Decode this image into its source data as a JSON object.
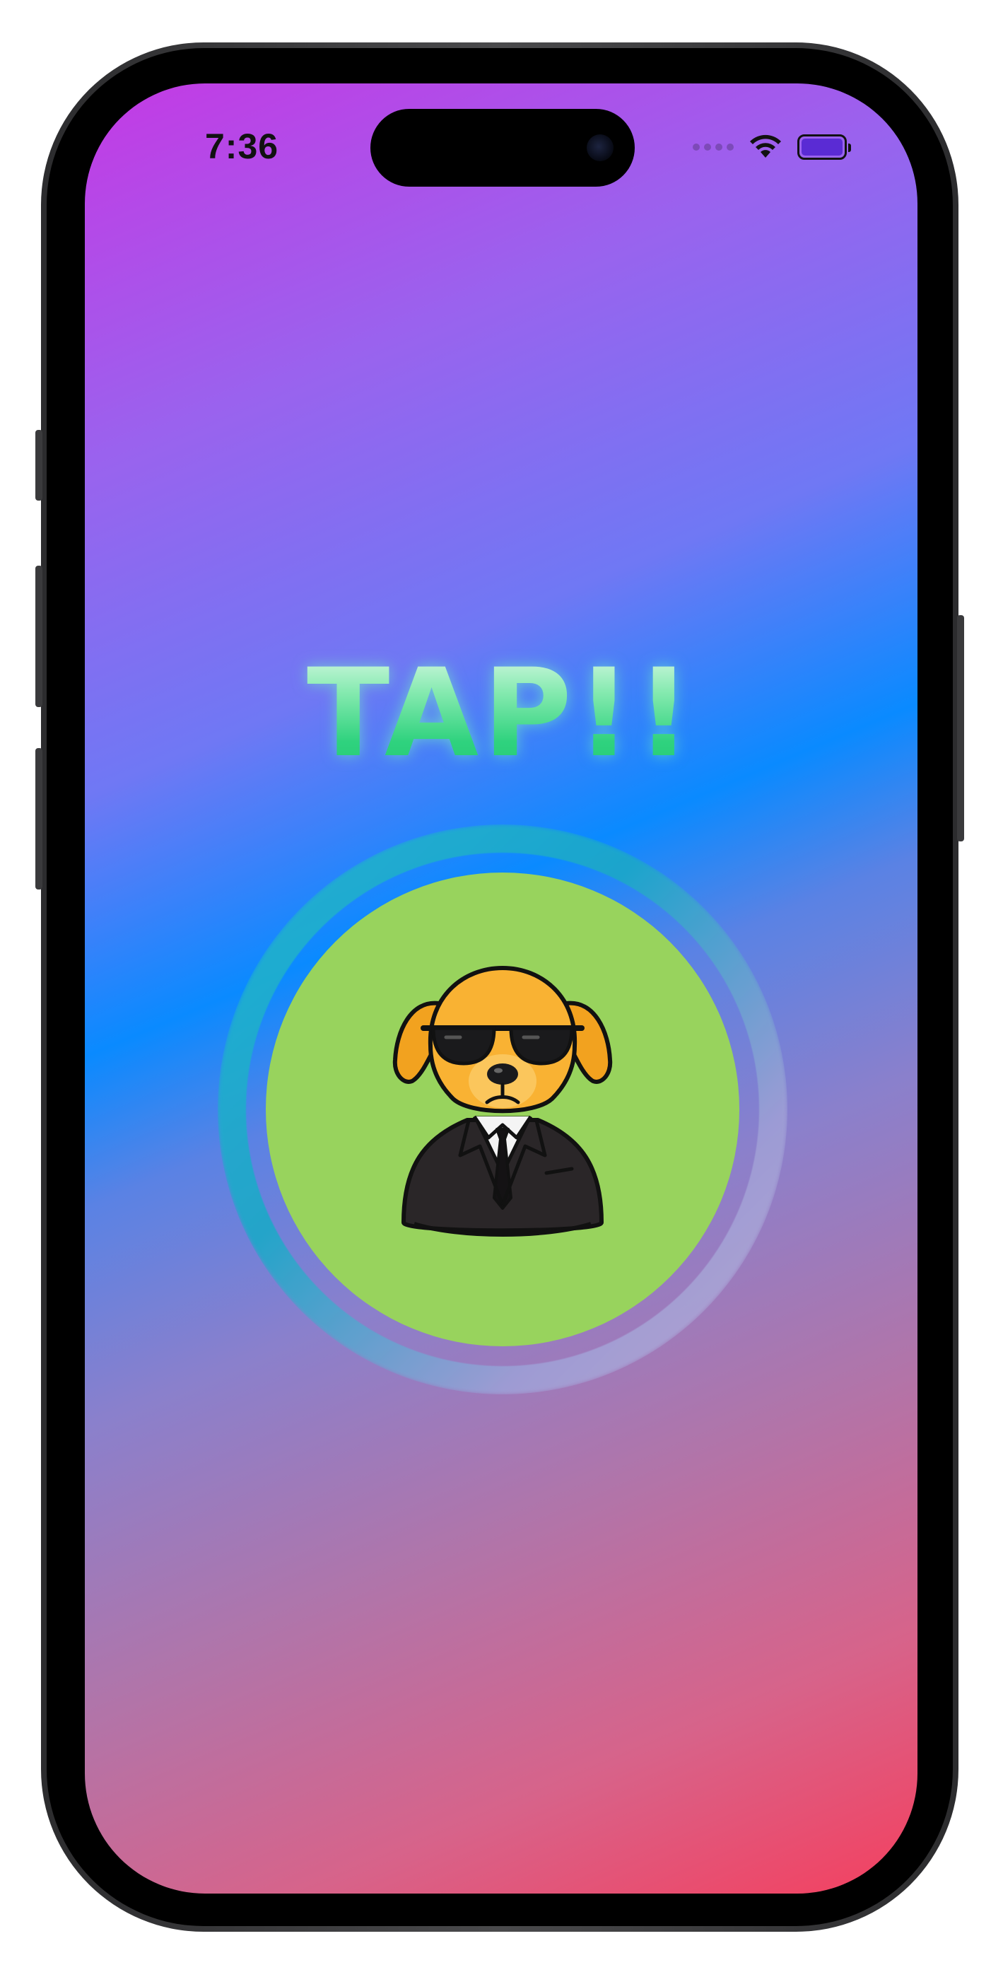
{
  "status_bar": {
    "time": "7:36",
    "battery_level": 1.0,
    "wifi_icon": "wifi-icon",
    "signal_icon": "cellular-dots-icon"
  },
  "main": {
    "title": "TAP!!",
    "tap_button": {
      "image": "dog-in-suit-with-sunglasses",
      "color": "#98d35d"
    }
  },
  "colors": {
    "background_top": "#c43ae4",
    "background_mid": "#0a8aff",
    "background_bottom": "#f4405f",
    "title_gradient_top": "#e8fbef",
    "title_gradient_bottom": "#22c872",
    "ring": "#23b6cf"
  }
}
